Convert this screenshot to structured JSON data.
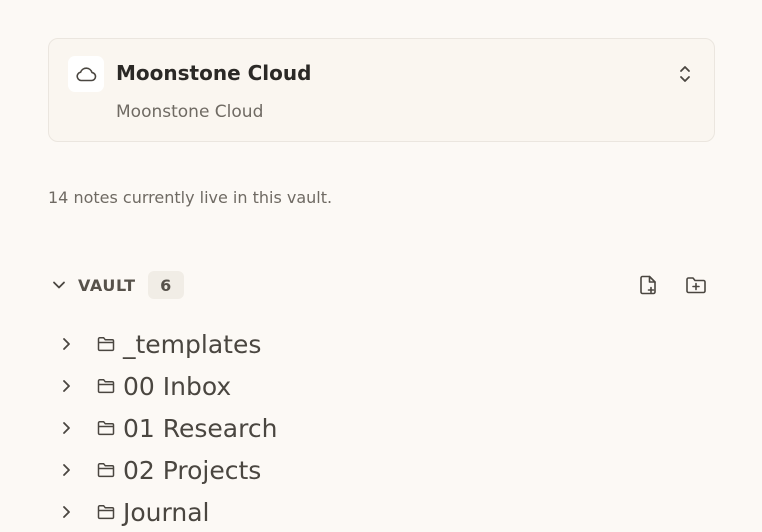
{
  "vault": {
    "name": "Moonstone Cloud",
    "subtitle": "Moonstone Cloud",
    "icon": "cloud-icon",
    "switcher_icon": "chevrons-up-down-icon"
  },
  "summary": "14 notes currently live in this vault.",
  "section": {
    "label": "VAULT",
    "count": "6",
    "actions": [
      "new-note-icon",
      "new-folder-icon"
    ]
  },
  "tree": [
    {
      "label": "_templates"
    },
    {
      "label": "00 Inbox"
    },
    {
      "label": "01 Research"
    },
    {
      "label": "02 Projects"
    },
    {
      "label": "Journal"
    }
  ],
  "colors": {
    "background": "#fcf9f5",
    "card": "#faf6f0",
    "border": "#ebe6df",
    "text": "#3a3733",
    "muted": "#6f6a63"
  }
}
